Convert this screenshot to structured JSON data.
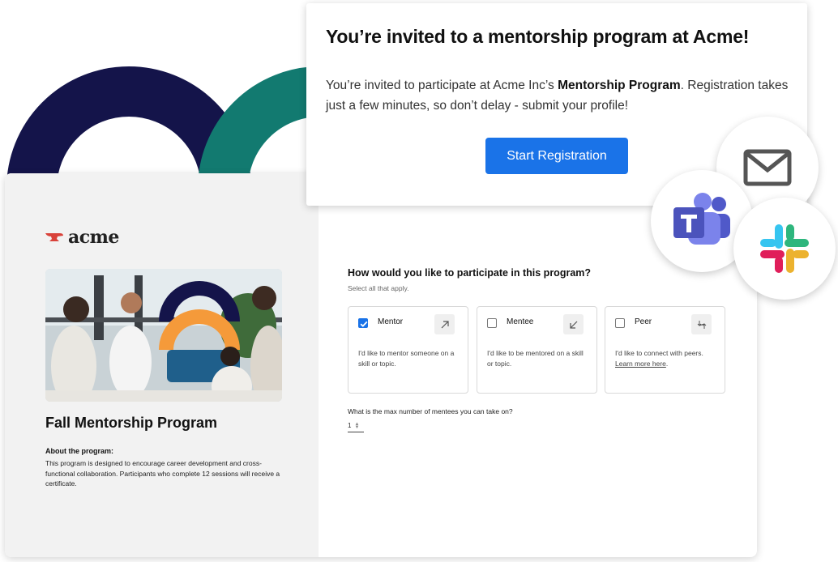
{
  "invite": {
    "title": "You’re invited to a mentorship program at Acme!",
    "body_prefix": "You’re invited to participate at Acme Inc’s ",
    "program_name": "Mentorship Program",
    "body_suffix": ". Registration takes just a few minutes, so don’t delay - submit your profile!",
    "button_label": "Start Registration"
  },
  "integrations": [
    "mail-icon",
    "microsoft-teams-icon",
    "slack-icon"
  ],
  "brand": {
    "logo_text": "acme",
    "accent_color": "#1a73e8",
    "navy": "#14144a",
    "teal": "#127a70",
    "orange": "#f59a3a",
    "logo_red": "#d9423a"
  },
  "program": {
    "title": "Fall Mentorship Program",
    "about_heading": "About the program:",
    "about_text": "This program is designed to encourage career development and cross-functional collaboration. Participants who complete 12 sessions will receive a certificate."
  },
  "form": {
    "question": "How would you like to participate in this program?",
    "hint": "Select all that apply.",
    "options": [
      {
        "label": "Mentor",
        "checked": true,
        "icon": "arrow-up-right-icon",
        "description": "I'd like to mentor someone on a skill or topic."
      },
      {
        "label": "Mentee",
        "checked": false,
        "icon": "arrow-down-left-icon",
        "description": "I'd like to be mentored on a skill or topic."
      },
      {
        "label": "Peer",
        "checked": false,
        "icon": "arrows-swap-icon",
        "description": "I'd like to connect with peers.",
        "link": "Learn more here",
        "link_suffix": "."
      }
    ],
    "max_mentees_label": "What is the max number of mentees you can take on?",
    "max_mentees_value": "1"
  }
}
